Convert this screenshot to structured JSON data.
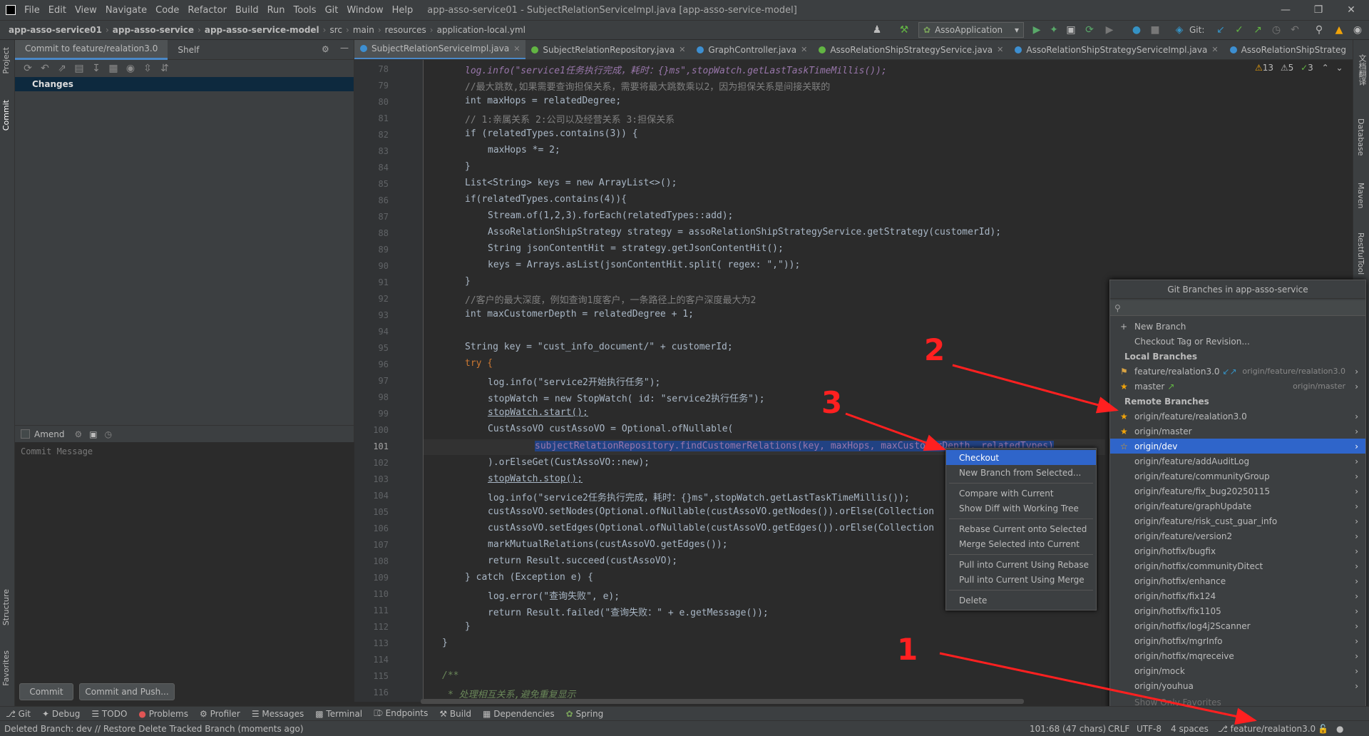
{
  "menubar": {
    "items": [
      "File",
      "Edit",
      "View",
      "Navigate",
      "Code",
      "Refactor",
      "Build",
      "Run",
      "Tools",
      "Git",
      "Window",
      "Help"
    ],
    "title": "app-asso-service01 - SubjectRelationServiceImpl.java [app-asso-service-model]"
  },
  "breadcrumb": [
    "app-asso-service01",
    "app-asso-service",
    "app-asso-service-model",
    "src",
    "main",
    "resources",
    "application-local.yml"
  ],
  "toolbar": {
    "run_config": "AssoApplication",
    "git_label": "Git:"
  },
  "commit_panel": {
    "tab_commit": "Commit to feature/realation3.0",
    "tab_shelf": "Shelf",
    "changes": "Changes",
    "amend": "Amend",
    "message_placeholder": "Commit Message",
    "commit_btn": "Commit",
    "commit_push_btn": "Commit and Push..."
  },
  "left_stripe": {
    "project": "Project",
    "commit": "Commit",
    "structure": "Structure",
    "favorites": "Favorites"
  },
  "right_stripe": {
    "t1": "文档翻译",
    "t2": "Database",
    "t3": "Maven",
    "t4": "RestfulTool"
  },
  "editor_tabs": [
    {
      "label": "SubjectRelationServiceImpl.java",
      "color": "#3d8fd1"
    },
    {
      "label": "SubjectRelationRepository.java",
      "color": "#62b543"
    },
    {
      "label": "GraphController.java",
      "color": "#3d8fd1"
    },
    {
      "label": "AssoRelationShipStrategyService.java",
      "color": "#62b543"
    },
    {
      "label": "AssoRelationShipStrategyServiceImpl.java",
      "color": "#3d8fd1"
    },
    {
      "label": "AssoRelationShipStrateg",
      "color": "#3d8fd1"
    }
  ],
  "inspections": {
    "warnings": "13",
    "weak": "5",
    "typos": "3"
  },
  "line_numbers": [
    "78",
    "79",
    "80",
    "81",
    "82",
    "83",
    "84",
    "85",
    "86",
    "87",
    "88",
    "89",
    "90",
    "91",
    "92",
    "93",
    "94",
    "95",
    "96",
    "97",
    "98",
    "99",
    "100",
    "101",
    "102",
    "103",
    "104",
    "105",
    "106",
    "107",
    "108",
    "109",
    "110",
    "111",
    "112",
    "113",
    "114",
    "115",
    "116"
  ],
  "code": {
    "l78": "log.info(\"service1任务执行完成，耗时：{}ms\",stopWatch.getLastTaskTimeMillis());",
    "l79": "//最大跳数,如果需要查询担保关系，需要将最大跳数乘以2，因为担保关系是间接关联的",
    "l80": "int maxHops = relatedDegree;",
    "l81": "// 1:亲属关系 2:公司以及经营关系 3:担保关系",
    "l82": "if (relatedTypes.contains(3)) {",
    "l83": "maxHops *= 2;",
    "l84": "}",
    "l85": "List<String> keys = new ArrayList<>();",
    "l86": "if(relatedTypes.contains(4)){",
    "l87": "Stream.of(1,2,3).forEach(relatedTypes::add);",
    "l88": "AssoRelationShipStrategy strategy = assoRelationShipStrategyService.getStrategy(customerId);",
    "l89": "String jsonContentHit = strategy.getJsonContentHit();",
    "l90": "keys = Arrays.asList(jsonContentHit.split( regex: \",\"));",
    "l91": "}",
    "l92": "//客户的最大深度，例如查询1度客户，一条路径上的客户深度最大为2",
    "l93": "int maxCustomerDepth = relatedDegree + 1;",
    "l95": "String key = \"cust_info_document/\" + customerId;",
    "l96": "try {",
    "l97": "log.info(\"service2开始执行任务\");",
    "l98": "stopWatch = new StopWatch( id: \"service2执行任务\");",
    "l99": "stopWatch.start();",
    "l100": "CustAssoVO custAssoVO = Optional.ofNullable(",
    "l101": "subjectRelationRepository.findCustomerRelations(key, maxHops, maxCustomerDepth, relatedTypes)",
    "l102": ").orElseGet(CustAssoVO::new);",
    "l103": "stopWatch.stop();",
    "l104": "log.info(\"service2任务执行完成，耗时：{}ms\",stopWatch.getLastTaskTimeMillis());",
    "l105": "custAssoVO.setNodes(Optional.ofNullable(custAssoVO.getNodes()).orElse(Collection",
    "l106": "custAssoVO.setEdges(Optional.ofNullable(custAssoVO.getEdges()).orElse(Collection",
    "l107": "markMutualRelations(custAssoVO.getEdges());",
    "l108": "return Result.succeed(custAssoVO);",
    "l109": "} catch (Exception e) {",
    "l110": "log.error(\"查询失败\", e);",
    "l111": "return Result.failed(\"查询失败：\" + e.getMessage());",
    "l112": "}",
    "l113": "}",
    "l115": "/**",
    "l116": "* 处理相互关系,避免重复显示"
  },
  "branches_popup": {
    "title": "Git Branches in app-asso-service",
    "new_branch": "New Branch",
    "checkout_tag": "Checkout Tag or Revision...",
    "local_header": "Local Branches",
    "local": [
      {
        "name": "feature/realation3.0",
        "track": "origin/feature/realation3.0"
      },
      {
        "name": "master",
        "track": "origin/master"
      }
    ],
    "remote_header": "Remote Branches",
    "remote": [
      "origin/feature/realation3.0",
      "origin/master",
      "origin/dev",
      "origin/feature/addAuditLog",
      "origin/feature/communityGroup",
      "origin/feature/fix_bug20250115",
      "origin/feature/graphUpdate",
      "origin/feature/risk_cust_guar_info",
      "origin/feature/version2",
      "origin/hotfix/bugfix",
      "origin/hotfix/communityDitect",
      "origin/hotfix/enhance",
      "origin/hotfix/fix124",
      "origin/hotfix/fix1105",
      "origin/hotfix/log4j2Scanner",
      "origin/hotfix/mgrInfo",
      "origin/hotfix/mqreceive",
      "origin/mock",
      "origin/youhua"
    ],
    "show_favorites": "Show Only Favorites"
  },
  "context_menu": [
    "Checkout",
    "New Branch from Selected...",
    "Compare with Current",
    "Show Diff with Working Tree",
    "Rebase Current onto Selected",
    "Merge Selected into Current",
    "Pull into Current Using Rebase",
    "Pull into Current Using Merge",
    "Delete"
  ],
  "bottom_tools": [
    "Git",
    "Debug",
    "TODO",
    "Problems",
    "Profiler",
    "Messages",
    "Terminal",
    "Endpoints",
    "Build",
    "Dependencies",
    "Spring"
  ],
  "status": {
    "message": "Deleted Branch: dev // Restore   Delete Tracked Branch (moments ago)",
    "position": "101:68 (47 chars)",
    "line_sep": "CRLF",
    "encoding": "UTF-8",
    "indent": "4 spaces",
    "branch": "feature/realation3.0"
  },
  "annotations": [
    "1",
    "2",
    "3"
  ],
  "colors": {
    "accent": "#2f65ca",
    "annotation": "#ff2020",
    "background": "#2b2b2b"
  }
}
